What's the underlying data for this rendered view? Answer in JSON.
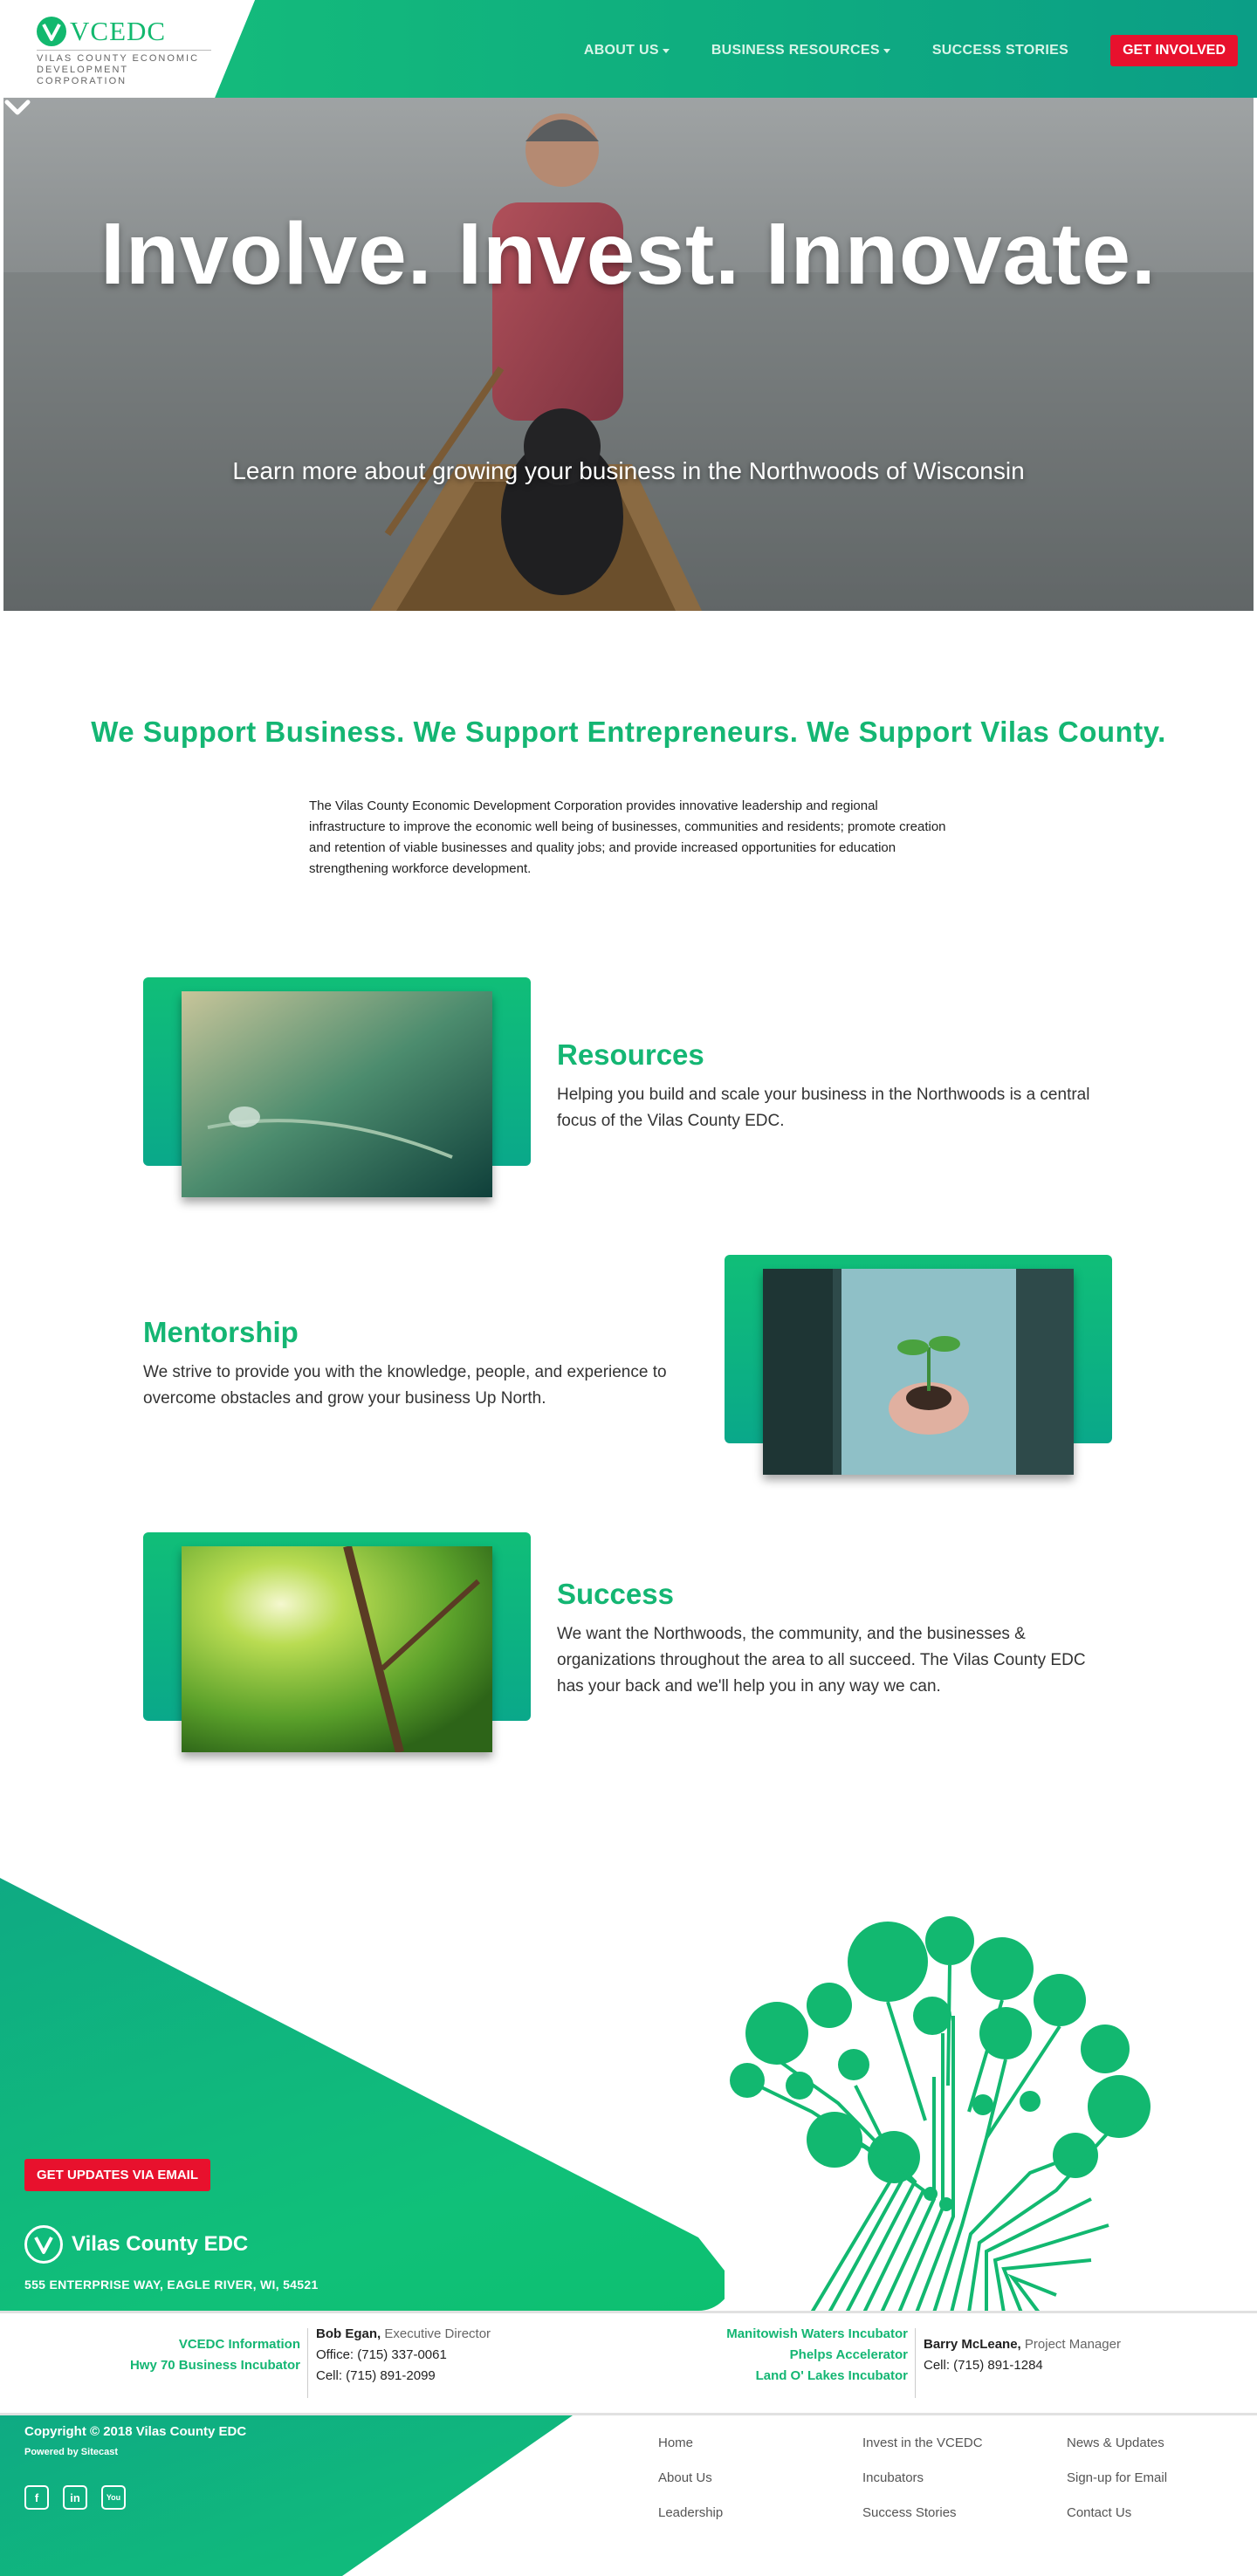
{
  "header": {
    "logo_text": "VCEDC",
    "logo_sub_line1": "VILAS COUNTY ECONOMIC",
    "logo_sub_line2": "DEVELOPMENT CORPORATION",
    "nav": [
      {
        "label": "ABOUT US",
        "has_dropdown": true
      },
      {
        "label": "BUSINESS RESOURCES",
        "has_dropdown": true
      },
      {
        "label": "SUCCESS STORIES",
        "has_dropdown": false
      }
    ],
    "cta_label": "GET INVOLVED"
  },
  "hero": {
    "title": "Involve. Invest. Innovate.",
    "subtitle": "Learn more about growing your business in the Northwoods of Wisconsin",
    "chevron_icon": "chevron-down-icon"
  },
  "intro": {
    "title": "We Support Business. We Support Entrepreneurs. We Support Vilas County.",
    "text": "The Vilas County Economic Development Corporation provides innovative leadership and regional infrastructure to improve the economic well being of businesses, communities and residents; promote creation and retention of viable businesses and quality jobs; and provide increased opportunities for education strengthening workforce development."
  },
  "features": [
    {
      "title": "Resources",
      "text": "Helping you build and scale your business in the Northwoods is a central focus of the Vilas County EDC."
    },
    {
      "title": "Mentorship",
      "text": "We strive to provide you with the knowledge, people, and experience to overcome obstacles and grow your business Up North."
    },
    {
      "title": "Success",
      "text": "We want the Northwoods, the community, and the businesses & organizations throughout the area to all succeed. The Vilas County EDC has your back and we'll help you in any way we can."
    }
  ],
  "footer": {
    "email_button": "GET UPDATES VIA EMAIL",
    "brand_name": "Vilas County EDC",
    "address": "555 ENTERPRISE WAY, EAGLE RIVER, WI, 54521",
    "contact_left_links": [
      "VCEDC Information",
      "Hwy 70 Business Incubator"
    ],
    "contact_left_person": {
      "name": "Bob Egan,",
      "role": "Executive Director",
      "office": "Office: (715) 337-0061",
      "cell": "Cell: (715) 891-2099"
    },
    "contact_right_links": [
      "Manitowish Waters Incubator",
      "Phelps Accelerator",
      "Land O' Lakes Incubator"
    ],
    "contact_right_person": {
      "name": "Barry McLeane,",
      "role": "Project Manager",
      "cell": "Cell: (715) 891-1284"
    },
    "copyright": "Copyright © 2018 Vilas County EDC",
    "powered": "Powered by Sitecast",
    "social": [
      {
        "icon": "facebook-icon",
        "glyph": "f"
      },
      {
        "icon": "linkedin-icon",
        "glyph": "in"
      },
      {
        "icon": "youtube-icon",
        "glyph": "You"
      }
    ],
    "columns": [
      [
        "Home",
        "About Us",
        "Leadership"
      ],
      [
        "Invest in the VCEDC",
        "Incubators",
        "Success Stories"
      ],
      [
        "News & Updates",
        "Sign-up for Email",
        "Contact Us"
      ]
    ]
  },
  "colors": {
    "brand_green": "#14b673",
    "cta_red": "#e8112d"
  }
}
